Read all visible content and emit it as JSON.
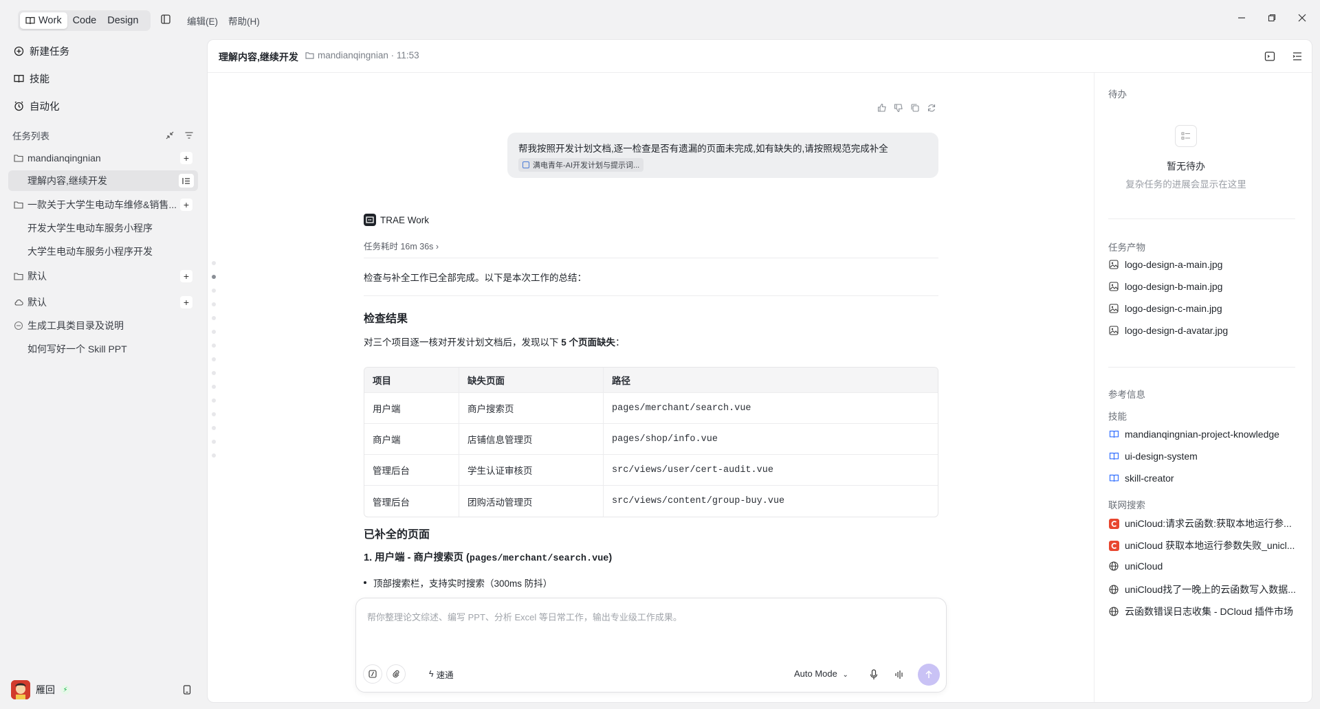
{
  "topbar": {
    "modes": [
      "Work",
      "Code",
      "Design"
    ],
    "active_mode": "Work",
    "menu_edit": "编辑(E)",
    "menu_help": "帮助(H)"
  },
  "sidebar": {
    "new_task": "新建任务",
    "skills": "技能",
    "automation": "自动化",
    "task_list_title": "任务列表",
    "groups": [
      {
        "name": "mandianqingnian",
        "children": [
          "理解内容,继续开发"
        ]
      },
      {
        "name": "一款关于大学生电动车维修&销售...",
        "children": [
          "开发大学生电动车服务小程序",
          "大学生电动车服务小程序开发"
        ]
      },
      {
        "name": "默认",
        "children": []
      },
      {
        "name": "默认",
        "children": []
      },
      {
        "name": "生成工具类目录及说明",
        "children": [
          "如何写好一个 Skill PPT"
        ]
      }
    ],
    "user_name": "雁回"
  },
  "main": {
    "title": "理解内容,继续开发",
    "folder": "mandianqingnian",
    "time": "11:53",
    "user_message": "帮我按照开发计划文档,逐一检查是否有遗漏的页面未完成,如有缺失的,请按照规范完成补全",
    "attachment": "满电青年-AI开发计划与提示词...",
    "bot_name": "TRAE Work",
    "duration": "任务耗时 16m 36s",
    "summary": "检查与补全工作已全部完成。以下是本次工作的总结：",
    "h_check": "检查结果",
    "check_intro_prefix": "对三个项目逐一核对开发计划文档后，发现以下 ",
    "check_intro_bold": "5 个页面缺失",
    "check_intro_suffix": "：",
    "table": {
      "headers": [
        "项目",
        "缺失页面",
        "路径"
      ],
      "rows": [
        [
          "用户端",
          "商户搜索页",
          "pages/merchant/search.vue"
        ],
        [
          "商户端",
          "店铺信息管理页",
          "pages/shop/info.vue"
        ],
        [
          "管理后台",
          "学生认证审核页",
          "src/views/user/cert-audit.vue"
        ],
        [
          "管理后台",
          "团购活动管理页",
          "src/views/content/group-buy.vue"
        ]
      ]
    },
    "h_done": "已补全的页面",
    "sub1_prefix": "1. 用户端 - 商户搜索页 (",
    "sub1_code": "pages/merchant/search.vue",
    "sub1_suffix": ")",
    "bullet1": "顶部搜索栏，支持实时搜索（300ms 防抖）",
    "composer_placeholder": "帮你整理论文综述、编写 PPT、分析 Excel 等日常工作，输出专业级工作成果。",
    "speed_label": "速通",
    "mode_label": "Auto Mode"
  },
  "right_panel": {
    "todo_title": "待办",
    "todo_empty": "暂无待办",
    "todo_empty_sub": "复杂任务的进展会显示在这里",
    "artifacts_title": "任务产物",
    "artifacts": [
      "logo-design-a-main.jpg",
      "logo-design-b-main.jpg",
      "logo-design-c-main.jpg",
      "logo-design-d-avatar.jpg"
    ],
    "refs_title": "参考信息",
    "skills_title": "技能",
    "skills": [
      "mandianqingnian-project-knowledge",
      "ui-design-system",
      "skill-creator"
    ],
    "web_title": "联网搜索",
    "web": [
      {
        "label": "uniCloud:请求云函数:获取本地运行参...",
        "icon": "c-icon"
      },
      {
        "label": "uniCloud 获取本地运行参数失败_unicl...",
        "icon": "c-icon"
      },
      {
        "label": "uniCloud",
        "icon": "globe-icon"
      },
      {
        "label": "uniCloud找了一晚上的云函数写入数据...",
        "icon": "globe-icon"
      },
      {
        "label": "云函数错误日志收集 - DCloud 插件市场",
        "icon": "globe-icon"
      }
    ]
  }
}
